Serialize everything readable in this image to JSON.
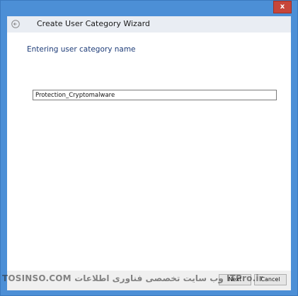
{
  "window": {
    "close_label": "x"
  },
  "wizard": {
    "title": "Create User Category Wizard",
    "back_icon": "back-arrow-icon",
    "step_heading": "Entering user category name"
  },
  "form": {
    "category_name": "Protection_Cryptomalware"
  },
  "footer": {
    "next_label": "Next",
    "cancel_label": "Cancel"
  },
  "watermark": {
    "text": "TOSINSO.COM وب سایت تخصصی فناوری اطلاعات ITPro.ir"
  },
  "colors": {
    "frame": "#4c8fd6",
    "close": "#c7463a",
    "heading": "#1e3c78"
  }
}
